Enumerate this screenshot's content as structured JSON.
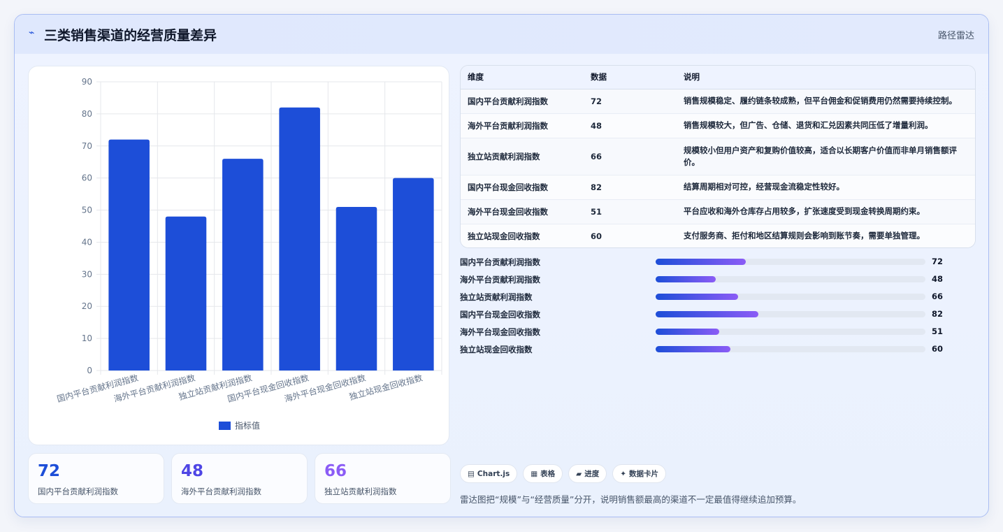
{
  "header": {
    "icon": "lightning-icon",
    "title": "三类销售渠道的经营质量差异",
    "tag": "路径雷达"
  },
  "chart_data": {
    "type": "bar",
    "categories": [
      "国内平台贡献利润指数",
      "海外平台贡献利润指数",
      "独立站贡献利润指数",
      "国内平台现金回收指数",
      "海外平台现金回收指数",
      "独立站现金回收指数"
    ],
    "series": [
      {
        "name": "指标值",
        "values": [
          72,
          48,
          66,
          82,
          51,
          60
        ],
        "color": "#1d4ed8"
      }
    ],
    "ylim": [
      0,
      90
    ],
    "yticks": [
      0,
      10,
      20,
      30,
      40,
      50,
      60,
      70,
      80,
      90
    ],
    "grid": true,
    "legend": "bottom"
  },
  "kpis": [
    {
      "value": "72",
      "label": "国内平台贡献利润指数",
      "color": "#1d4ed8"
    },
    {
      "value": "48",
      "label": "海外平台贡献利润指数",
      "color": "#4f46e5"
    },
    {
      "value": "66",
      "label": "独立站贡献利润指数",
      "color": "#8b5cf6"
    }
  ],
  "table": {
    "headers": [
      "维度",
      "数据",
      "说明"
    ],
    "rows": [
      {
        "dim": "国内平台贡献利润指数",
        "value": "72",
        "desc": "销售规模稳定、履约链条较成熟，但平台佣金和促销费用仍然需要持续控制。"
      },
      {
        "dim": "海外平台贡献利润指数",
        "value": "48",
        "desc": "销售规模较大，但广告、仓储、退货和汇兑因素共同压低了增量利润。"
      },
      {
        "dim": "独立站贡献利润指数",
        "value": "66",
        "desc": "规模较小但用户资产和复购价值较高，适合以长期客户价值而非单月销售额评价。"
      },
      {
        "dim": "国内平台现金回收指数",
        "value": "82",
        "desc": "结算周期相对可控，经营现金流稳定性较好。"
      },
      {
        "dim": "海外平台现金回收指数",
        "value": "51",
        "desc": "平台应收和海外仓库存占用较多，扩张速度受到现金转换周期约束。"
      },
      {
        "dim": "独立站现金回收指数",
        "value": "60",
        "desc": "支付服务商、拒付和地区结算规则会影响到账节奏，需要单独管理。"
      }
    ]
  },
  "progress": {
    "max": 216,
    "items": [
      {
        "label": "国内平台贡献利润指数",
        "value": 72
      },
      {
        "label": "海外平台贡献利润指数",
        "value": 48
      },
      {
        "label": "独立站贡献利润指数",
        "value": 66
      },
      {
        "label": "国内平台现金回收指数",
        "value": 82
      },
      {
        "label": "海外平台现金回收指数",
        "value": 51
      },
      {
        "label": "独立站现金回收指数",
        "value": 60
      }
    ]
  },
  "chips": [
    {
      "icon": "chart-icon",
      "glyph": "▤",
      "label": "Chart.js"
    },
    {
      "icon": "table-icon",
      "glyph": "▦",
      "label": "表格"
    },
    {
      "icon": "progress-icon",
      "glyph": "▰",
      "label": "进度"
    },
    {
      "icon": "sparkle-icon",
      "glyph": "✦",
      "label": "数据卡片"
    }
  ],
  "note": "雷达图把“规模”与“经营质量”分开，说明销售额最高的渠道不一定最值得继续追加预算。"
}
